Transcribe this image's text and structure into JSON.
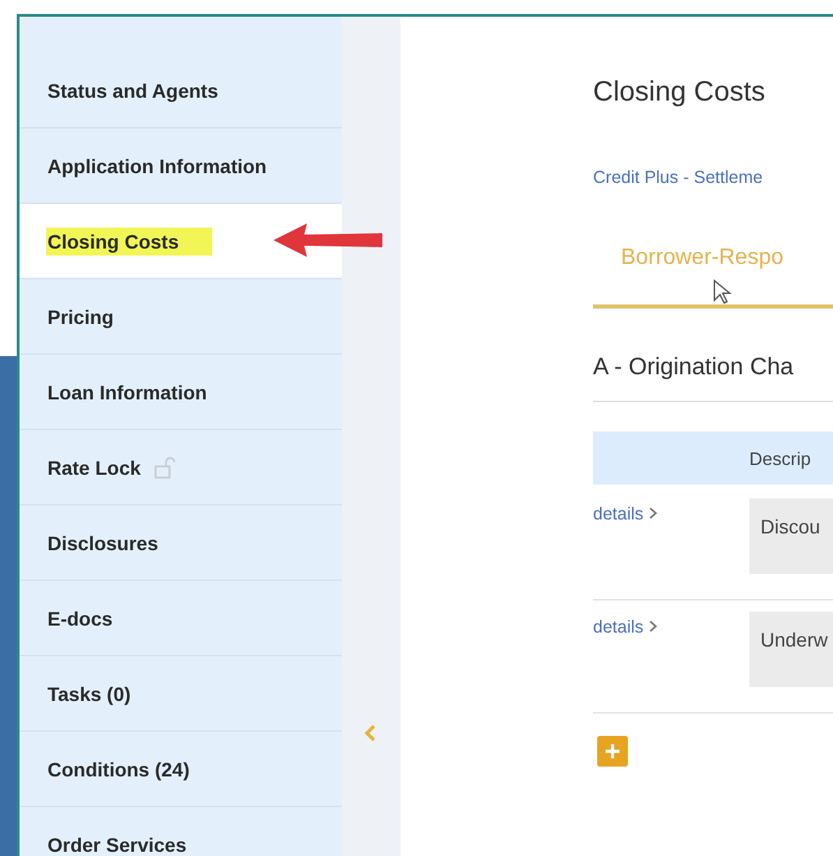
{
  "sidebar": {
    "items": [
      {
        "label": "Status and Agents",
        "selected": false,
        "highlighted": false,
        "lock_icon": false
      },
      {
        "label": "Application Information",
        "selected": false,
        "highlighted": false,
        "lock_icon": false
      },
      {
        "label": "Closing Costs",
        "selected": true,
        "highlighted": true,
        "lock_icon": false
      },
      {
        "label": "Pricing",
        "selected": false,
        "highlighted": false,
        "lock_icon": false
      },
      {
        "label": "Loan Information",
        "selected": false,
        "highlighted": false,
        "lock_icon": false
      },
      {
        "label": "Rate Lock",
        "selected": false,
        "highlighted": false,
        "lock_icon": true
      },
      {
        "label": "Disclosures",
        "selected": false,
        "highlighted": false,
        "lock_icon": false
      },
      {
        "label": "E-docs",
        "selected": false,
        "highlighted": false,
        "lock_icon": false
      },
      {
        "label": "Tasks (0)",
        "selected": false,
        "highlighted": false,
        "lock_icon": false
      },
      {
        "label": "Conditions (24)",
        "selected": false,
        "highlighted": false,
        "lock_icon": false
      },
      {
        "label": "Order Services",
        "selected": false,
        "highlighted": false,
        "lock_icon": false
      }
    ]
  },
  "main": {
    "title": "Closing Costs",
    "link": "Credit Plus - Settleme",
    "tabs": [
      {
        "label": "Borrower-Respo",
        "selected": true
      }
    ],
    "section": {
      "title": "A - Origination Cha",
      "table": {
        "columns": [
          "Descrip"
        ],
        "rows": [
          {
            "link": "details",
            "description": "Discou"
          },
          {
            "link": "details",
            "description": "Underw"
          }
        ]
      }
    }
  }
}
